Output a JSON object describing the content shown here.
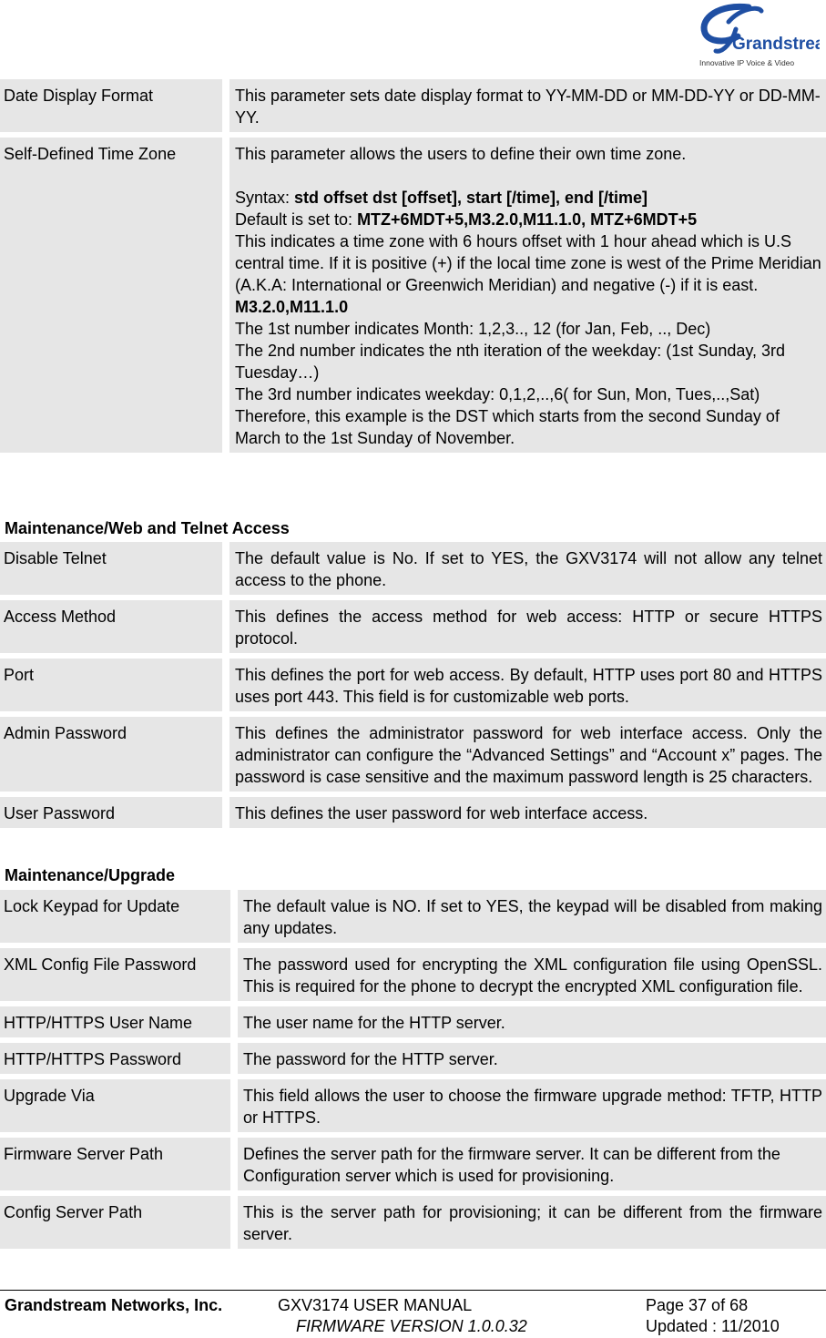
{
  "header": {
    "logo_name": "Grandstream",
    "logo_tagline": "Innovative IP Voice & Video"
  },
  "table1": {
    "rows": [
      {
        "name": "Date Display Format",
        "desc": "This parameter sets date display format to YY-MM-DD or MM-DD-YY or DD-MM-YY."
      },
      {
        "name": "Self-Defined Time Zone",
        "intro": "This parameter allows the users to define their own time zone.",
        "syntax_label": "Syntax: ",
        "syntax_value": "std offset dst [offset], start [/time], end [/time]",
        "default_label": "Default is set to: ",
        "default_value": "MTZ+6MDT+5,M3.2.0,M11.1.0, MTZ+6MDT+5",
        "explanation": "This indicates a time zone with 6 hours offset with 1 hour ahead which is U.S central time. If it is positive (+) if the local time zone is west of the Prime Meridian (A.K.A: International or Greenwich Meridian) and negative (-) if it is east.",
        "example": "M3.2.0,M11.1.0",
        "line1": "The 1st number indicates Month: 1,2,3.., 12 (for Jan, Feb, .., Dec)",
        "line2": "The 2nd number indicates the nth iteration of the weekday: (1st Sunday, 3rd Tuesday…)",
        "line3": "The 3rd number indicates weekday: 0,1,2,..,6( for Sun, Mon, Tues,..,Sat)",
        "line4": "Therefore, this example is the DST which starts from the second Sunday of March to the 1st Sunday of November."
      }
    ]
  },
  "section2": {
    "title": "Maintenance/Web and Telnet Access",
    "rows": [
      {
        "name": "Disable Telnet",
        "desc": "The default value is No. If set to YES, the GXV3174 will not allow any telnet access to the phone."
      },
      {
        "name": "Access Method",
        "desc": "This defines the access method for web access: HTTP or secure HTTPS protocol."
      },
      {
        "name": "Port",
        "desc": "This defines the port for web access. By default, HTTP uses port 80 and HTTPS uses port 443. This field is for customizable web ports."
      },
      {
        "name": "Admin Password",
        "desc": "This defines the administrator password for web interface access. Only the administrator can configure the “Advanced Settings” and “Account x” pages. The password is case sensitive and the maximum password length is 25 characters."
      },
      {
        "name": "User Password",
        "desc": "This defines the user password for web interface access."
      }
    ]
  },
  "section3": {
    "title": "Maintenance/Upgrade",
    "rows": [
      {
        "name": "Lock Keypad for Update",
        "desc": "The default value is NO. If set to YES, the keypad will be disabled from making any updates."
      },
      {
        "name": "XML Config File Password",
        "desc": "The password used for encrypting the XML configuration file using OpenSSL. This is required for the phone to decrypt the encrypted XML configuration file."
      },
      {
        "name": "HTTP/HTTPS User Name",
        "desc": "The user name for the HTTP server."
      },
      {
        "name": "HTTP/HTTPS Password",
        "desc": "The password for the HTTP server."
      },
      {
        "name": "Upgrade Via",
        "desc": "This field allows the user to choose the firmware upgrade method: TFTP, HTTP or HTTPS."
      },
      {
        "name": "Firmware Server Path",
        "desc": "Defines the server path for the firmware server. It can be different from the Configuration server which is used for provisioning."
      },
      {
        "name": "Config Server Path",
        "desc": "This is the server path for provisioning; it can be different from the firmware server."
      }
    ]
  },
  "footer": {
    "company": "Grandstream Networks, Inc.",
    "manual": "GXV3174 USER MANUAL",
    "firmware": "FIRMWARE VERSION 1.0.0.32",
    "page": "Page 37 of 68",
    "updated": "Updated : 11/2010"
  }
}
